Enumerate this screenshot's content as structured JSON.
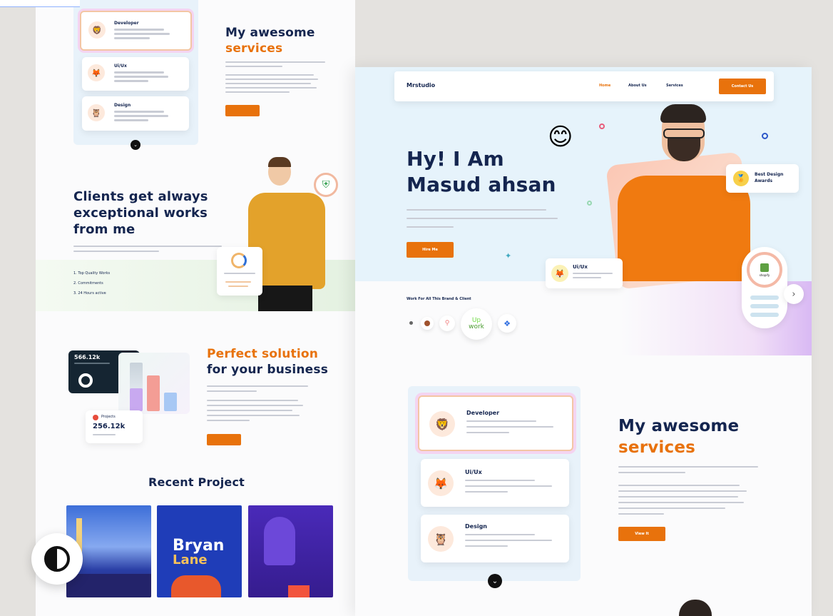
{
  "left_page": {
    "services_cards": [
      {
        "title": "Developer",
        "icon": "developer-icon"
      },
      {
        "title": "Ui/Ux",
        "icon": "uiux-icon"
      },
      {
        "title": "Design",
        "icon": "design-icon"
      }
    ],
    "services_heading_1": "My awesome",
    "services_heading_2": "services",
    "clients_heading": [
      "Clients get always",
      "exceptional works",
      "from me"
    ],
    "clients_list": [
      "1. Top Quality Works",
      "2. Commitments",
      "3. 24 Hours active"
    ],
    "stat_big": "566.12k",
    "stat_small": "256.12k",
    "stat_small_label": "Projects",
    "perfect_heading_1": "Perfect solution",
    "perfect_heading_2": "for your business",
    "recent_heading": "Recent Project",
    "project_2_text_1": "Bryan",
    "project_2_text_2": "Lane"
  },
  "right_page": {
    "brand": "Mrstudio",
    "nav": [
      "Home",
      "About Us",
      "Services"
    ],
    "contact_label": "Contact Us",
    "hero_line_1": "Hy! I Am",
    "hero_line_2": "Masud ahsan",
    "hire_label": "Hire Me",
    "award_label_1": "Best Design",
    "award_label_2": "Awards",
    "uiux_badge": "Ui/Ux",
    "shopify_label": "shopify",
    "brands_heading": "Work For All This Brand & Client",
    "upwork_1": "Up",
    "upwork_2": "work",
    "services_cards": [
      {
        "title": "Developer",
        "icon": "developer-icon"
      },
      {
        "title": "Ui/Ux",
        "icon": "uiux-icon"
      },
      {
        "title": "Design",
        "icon": "design-icon"
      }
    ],
    "services_heading_1": "My awesome",
    "services_heading_2": "services",
    "view_label": "View It"
  },
  "colors": {
    "accent": "#e8720c",
    "navy": "#14254f",
    "hero_bg": "#e6f3fb"
  }
}
